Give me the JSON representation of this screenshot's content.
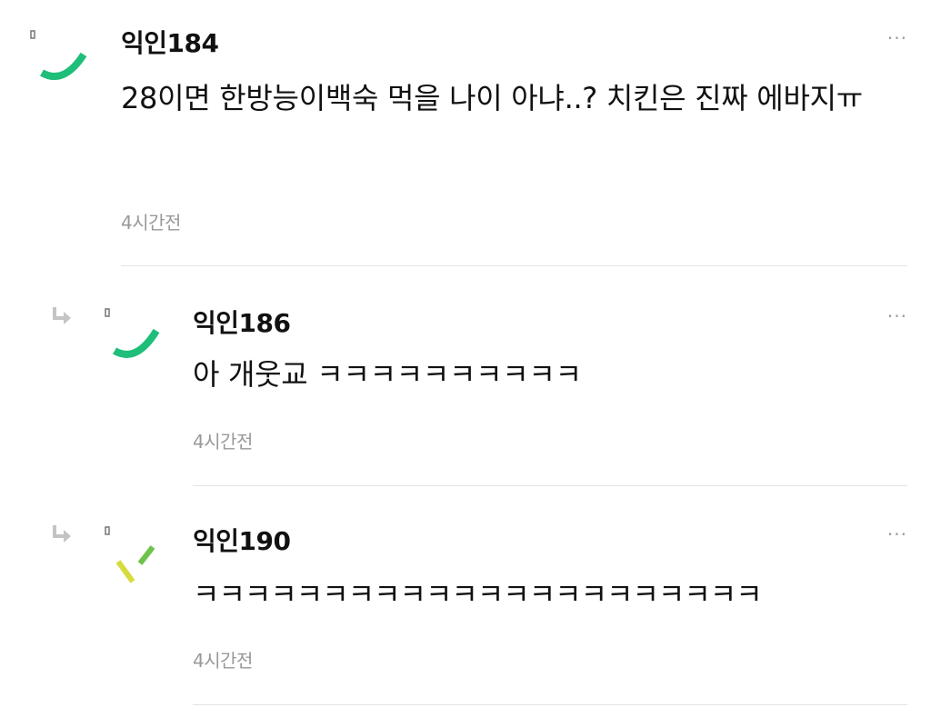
{
  "comments": [
    {
      "author": "익인184",
      "text": "28이면 한방능이백숙 먹을 나이 아냐..? 치킨은 진짜 에바지ㅠ",
      "time": "4시간전",
      "more_label": "···",
      "avatar_icon": "green-arc-avatar-icon",
      "avatar_color": "#1fbe7a"
    },
    {
      "author": "익인186",
      "text": "아 개웃교 ㅋㅋㅋㅋㅋㅋㅋㅋㅋㅋ",
      "time": "4시간전",
      "more_label": "···",
      "reply_icon": "reply-arrow-icon",
      "avatar_icon": "green-arc-avatar-icon",
      "avatar_color": "#1fbe7a"
    },
    {
      "author": "익인190",
      "text": "ㅋㅋㅋㅋㅋㅋㅋㅋㅋㅋㅋㅋㅋㅋㅋㅋㅋㅋㅋㅋㅋㅋ",
      "time": "4시간전",
      "more_label": "···",
      "reply_icon": "reply-arrow-icon",
      "avatar_icon": "green-dash-avatar-icon",
      "avatar_color": "#a4c83a"
    }
  ],
  "colors": {
    "text": "#111111",
    "time": "#999999",
    "divider": "#e3e3e3",
    "reply_icon": "#c4c4c4"
  }
}
